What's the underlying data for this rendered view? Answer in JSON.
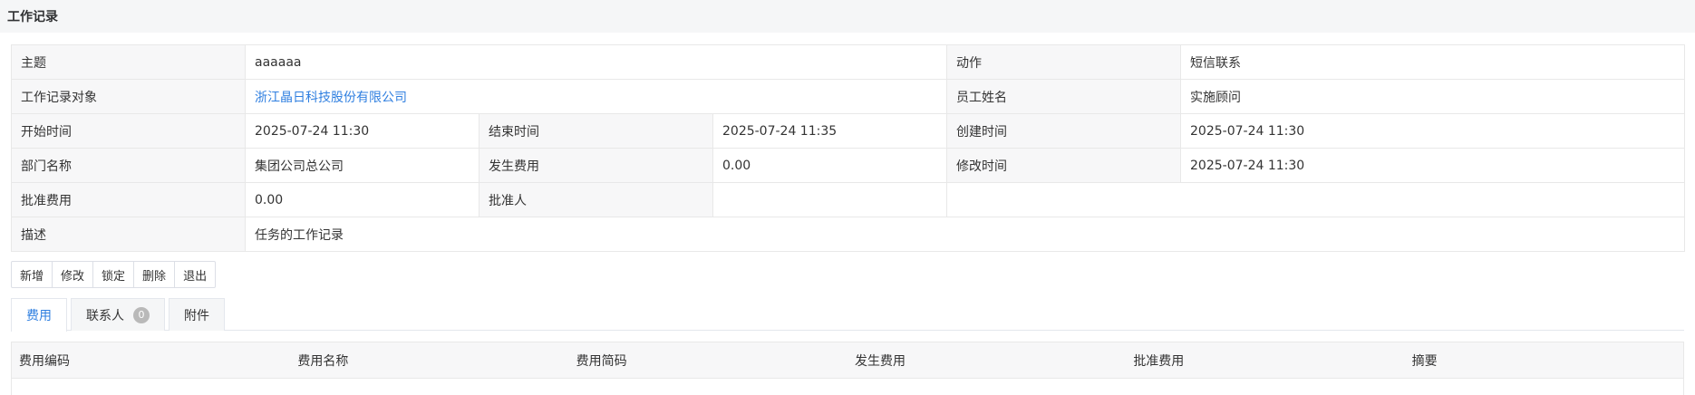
{
  "page": {
    "title": "工作记录"
  },
  "info": {
    "subject_label": "主题",
    "subject_value": "aaaaaa",
    "action_label": "动作",
    "action_value": "短信联系",
    "object_label": "工作记录对象",
    "object_value": "浙江晶日科技股份有限公司",
    "employee_label": "员工姓名",
    "employee_value": "实施顾问",
    "start_label": "开始时间",
    "start_value": "2025-07-24 11:30",
    "end_label": "结束时间",
    "end_value": "2025-07-24 11:35",
    "created_label": "创建时间",
    "created_value": "2025-07-24 11:30",
    "dept_label": "部门名称",
    "dept_value": "集团公司总公司",
    "cost_label": "发生费用",
    "cost_value": "0.00",
    "modified_label": "修改时间",
    "modified_value": "2025-07-24 11:30",
    "approved_cost_label": "批准费用",
    "approved_cost_value": "0.00",
    "approver_label": "批准人",
    "approver_value": "",
    "desc_label": "描述",
    "desc_value": "任务的工作记录"
  },
  "toolbar": {
    "add_label": "新增",
    "edit_label": "修改",
    "lock_label": "锁定",
    "delete_label": "删除",
    "exit_label": "退出"
  },
  "tabs": {
    "expense_label": "费用",
    "contacts_label": "联系人",
    "contacts_count": "0",
    "attachments_label": "附件"
  },
  "grid": {
    "columns": [
      "费用编码",
      "费用名称",
      "费用简码",
      "发生费用",
      "批准费用",
      "摘要"
    ]
  },
  "colors": {
    "accent": "#2f7fe0",
    "label_bg": "#f7f7f8",
    "header_bg": "#f5f6f7",
    "border": "#e8e8e8",
    "badge_bg": "#b9b9b9"
  }
}
